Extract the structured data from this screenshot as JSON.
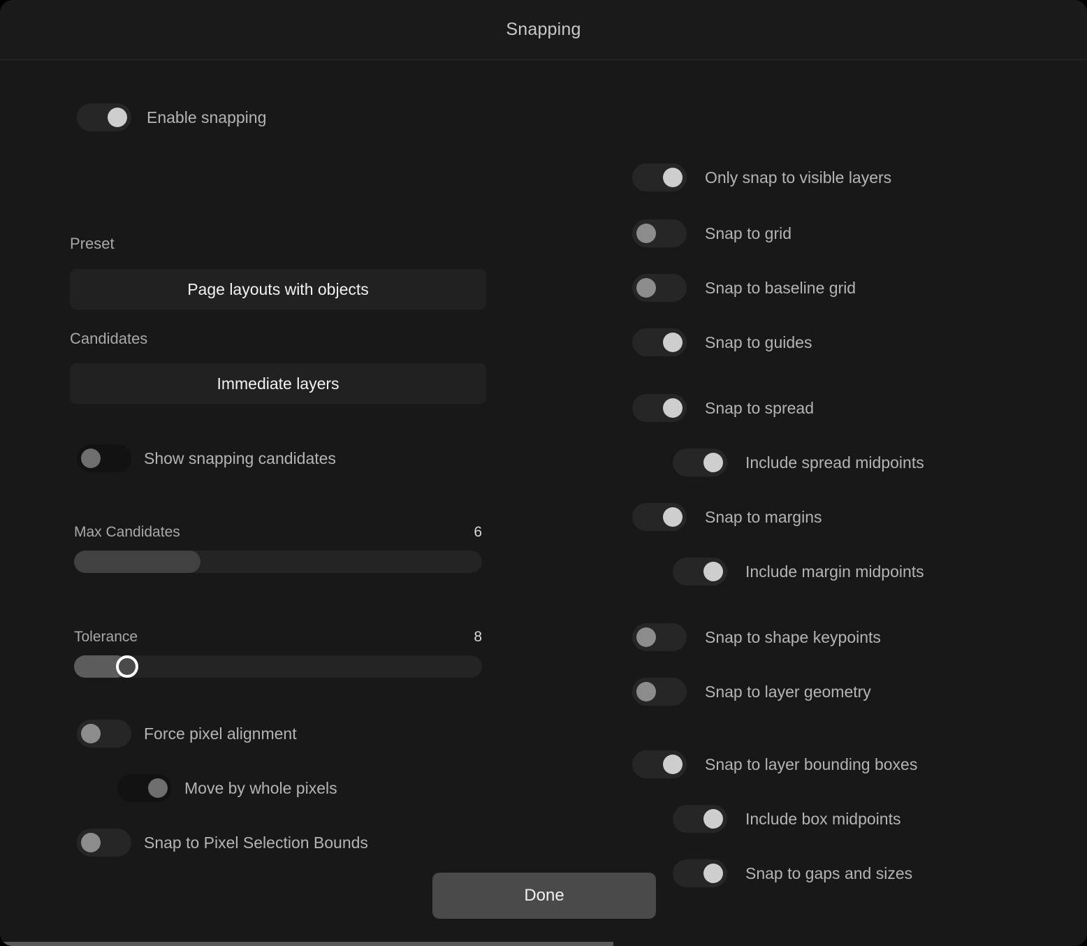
{
  "window": {
    "title": "Snapping"
  },
  "left": {
    "enable_snapping": {
      "label": "Enable snapping",
      "state": "on"
    },
    "preset": {
      "label": "Preset",
      "value": "Page layouts with objects"
    },
    "candidates": {
      "label": "Candidates",
      "value": "Immediate layers"
    },
    "show_snapping_candidates": {
      "label": "Show snapping candidates",
      "state": "off"
    },
    "max_candidates": {
      "label": "Max Candidates",
      "value": "6",
      "fill_percent": 31
    },
    "tolerance": {
      "label": "Tolerance",
      "value": "8",
      "fill_percent": 13
    },
    "force_pixel_alignment": {
      "label": "Force pixel alignment",
      "state": "off"
    },
    "move_by_whole_pixels": {
      "label": "Move by whole pixels",
      "state": "on-dim"
    },
    "snap_to_pixel_selection_bounds": {
      "label": "Snap to Pixel Selection Bounds",
      "state": "off"
    }
  },
  "right": {
    "items": [
      {
        "label": "Only snap to visible layers",
        "state": "on",
        "indent": 0
      },
      {
        "label": "Snap to grid",
        "state": "off",
        "indent": 0
      },
      {
        "label": "Snap to baseline grid",
        "state": "off",
        "indent": 0
      },
      {
        "label": "Snap to guides",
        "state": "on",
        "indent": 0
      },
      {
        "label": "Snap to spread",
        "state": "on",
        "indent": 0
      },
      {
        "label": "Include spread midpoints",
        "state": "on",
        "indent": 1
      },
      {
        "label": "Snap to margins",
        "state": "on",
        "indent": 0
      },
      {
        "label": "Include margin midpoints",
        "state": "on",
        "indent": 1
      },
      {
        "label": "Snap to shape keypoints",
        "state": "off",
        "indent": 0
      },
      {
        "label": "Snap to layer geometry",
        "state": "off",
        "indent": 0
      },
      {
        "label": "Snap to layer bounding boxes",
        "state": "on",
        "indent": 0
      },
      {
        "label": "Include box midpoints",
        "state": "on",
        "indent": 1
      },
      {
        "label": "Snap to gaps and sizes",
        "state": "on",
        "indent": 1
      }
    ]
  },
  "footer": {
    "done_label": "Done"
  },
  "colors": {
    "window_bg": "#181818",
    "titlebar_bg": "#1a1a1a",
    "switch_track": "#262626",
    "switch_knob_on": "#cecece",
    "switch_knob_off": "#8c8c8c",
    "accent_text": "#f2f2f2",
    "muted_text": "#b4b4b4",
    "done_bg": "#4a4a4a"
  }
}
